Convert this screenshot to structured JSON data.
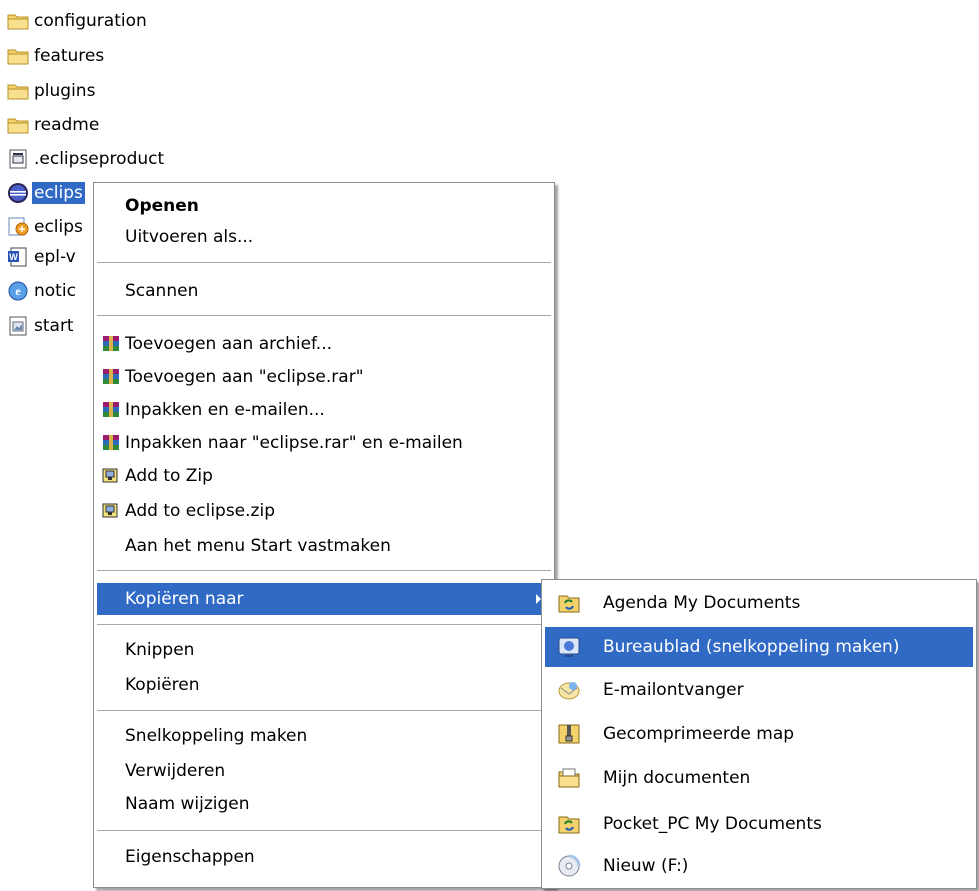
{
  "files": [
    {
      "name": "configuration",
      "icon": "folder-icon"
    },
    {
      "name": "features",
      "icon": "folder-icon"
    },
    {
      "name": "plugins",
      "icon": "folder-icon"
    },
    {
      "name": "readme",
      "icon": "folder-icon"
    },
    {
      "name": ".eclipseproduct",
      "icon": "config-file-icon"
    },
    {
      "name": "eclips",
      "icon": "eclipse-app-icon",
      "selected": true
    },
    {
      "name": "eclips",
      "icon": "eclipse-ini-icon"
    },
    {
      "name": "epl-v",
      "icon": "word-doc-icon"
    },
    {
      "name": "notic",
      "icon": "html-doc-icon"
    },
    {
      "name": "start",
      "icon": "image-file-icon"
    }
  ],
  "context_menu": {
    "open": "Openen",
    "run_as": "Uitvoeren als...",
    "scan": "Scannen",
    "add_to_archive": "Toevoegen aan archief...",
    "add_to_rar": "Toevoegen aan \"eclipse.rar\"",
    "pack_email": "Inpakken en e-mailen...",
    "pack_rar_email": "Inpakken naar \"eclipse.rar\" en e-mailen",
    "add_to_zip": "Add to Zip",
    "add_to_eclipse_zip": "Add to eclipse.zip",
    "pin_start": "Aan het menu Start vastmaken",
    "copy_to": "Kopiëren naar",
    "cut": "Knippen",
    "copy": "Kopiëren",
    "create_shortcut": "Snelkoppeling maken",
    "delete": "Verwijderen",
    "rename": "Naam wijzigen",
    "properties": "Eigenschappen"
  },
  "submenu": [
    {
      "label": "Agenda My Documents",
      "icon": "sync-folder-icon"
    },
    {
      "label": "Bureaublad (snelkoppeling maken)",
      "icon": "desktop-icon",
      "highlight": true
    },
    {
      "label": "E-mailontvanger",
      "icon": "mail-recipient-icon"
    },
    {
      "label": "Gecomprimeerde map",
      "icon": "zip-folder-icon"
    },
    {
      "label": "Mijn documenten",
      "icon": "my-documents-icon"
    },
    {
      "label": "Pocket_PC My Documents",
      "icon": "sync-folder-icon"
    },
    {
      "label": "Nieuw (F:)",
      "icon": "cd-drive-icon"
    }
  ],
  "colors": {
    "highlight": "#316ac5",
    "folder": "#f3d26b",
    "separator": "#a9a9a9"
  }
}
